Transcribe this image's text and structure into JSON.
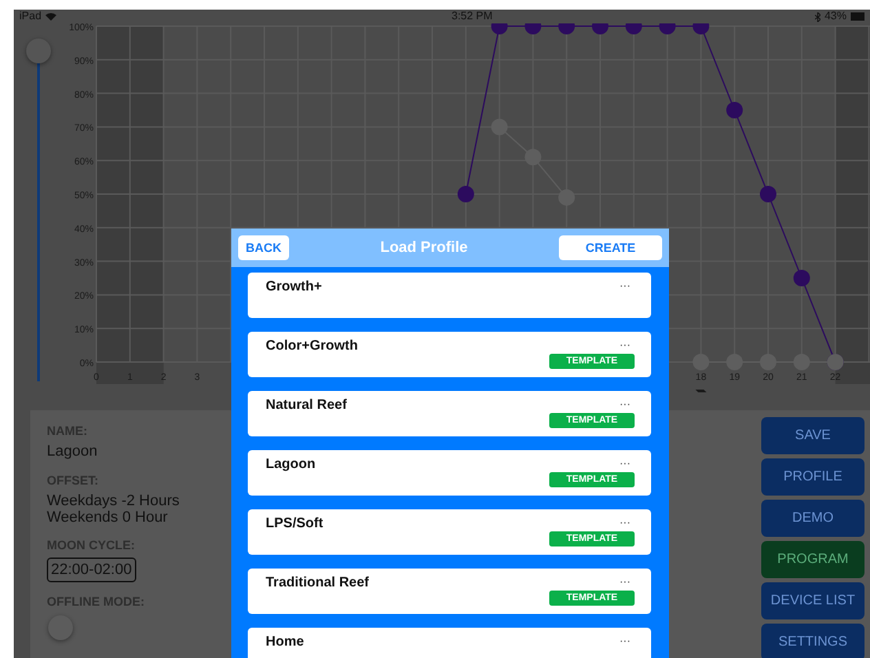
{
  "status_bar": {
    "device": "iPad",
    "time": "3:52 PM",
    "battery": "43%"
  },
  "slider": {
    "level": 1
  },
  "chart_data": {
    "type": "line",
    "x": [
      11,
      12,
      13,
      14,
      15,
      16,
      17,
      18,
      19,
      20,
      21,
      22
    ],
    "xlim": [
      0,
      23
    ],
    "ylim": [
      0,
      100
    ],
    "grid": true,
    "xticks": [
      0,
      1,
      2,
      3,
      18,
      19,
      20,
      21,
      22
    ],
    "yticks": [
      {
        "value": 0,
        "label": "0%"
      },
      {
        "value": 10,
        "label": "10%"
      },
      {
        "value": 20,
        "label": "20%"
      },
      {
        "value": 30,
        "label": "30%"
      },
      {
        "value": 40,
        "label": "40%"
      },
      {
        "value": 50,
        "label": "50%"
      },
      {
        "value": 60,
        "label": "60%"
      },
      {
        "value": 70,
        "label": "70%"
      },
      {
        "value": 80,
        "label": "80%"
      },
      {
        "value": 90,
        "label": "90%"
      },
      {
        "value": 100,
        "label": "100%"
      }
    ],
    "series": [
      {
        "color": "#2c0b5e",
        "marker": "circle",
        "values": [
          50,
          100,
          100,
          100,
          100,
          100,
          100,
          100,
          75,
          50,
          25,
          0
        ]
      },
      {
        "color": "#5e5e5e",
        "marker": "circle",
        "values": [
          null,
          70,
          61,
          49,
          null,
          null,
          null,
          0,
          0,
          0,
          0,
          0
        ]
      }
    ]
  },
  "settings": {
    "name_label": "NAME:",
    "name": "Lagoon",
    "offset_label": "OFFSET:",
    "offset_lines": [
      "Weekdays -2 Hours",
      "Weekends 0 Hour"
    ],
    "moon_label": "MOON CYCLE:",
    "moon_cycle": "22:00-02:00",
    "offline_label": "OFFLINE MODE:",
    "offline_on": false
  },
  "buttons": [
    {
      "label": "SAVE",
      "kind": "normal"
    },
    {
      "label": "PROFILE",
      "kind": "normal"
    },
    {
      "label": "DEMO",
      "kind": "normal"
    },
    {
      "label": "PROGRAM",
      "kind": "active"
    },
    {
      "label": "DEVICE LIST",
      "kind": "normal"
    },
    {
      "label": "SETTINGS",
      "kind": "normal"
    }
  ],
  "modal": {
    "title": "Load Profile",
    "back": "BACK",
    "create": "CREATE",
    "profiles": [
      {
        "name": "Growth+",
        "menu": "···",
        "template": false
      },
      {
        "name": "Color+Growth",
        "menu": "···",
        "template": true,
        "badge": "TEMPLATE"
      },
      {
        "name": "Natural Reef",
        "menu": "···",
        "template": true,
        "badge": "TEMPLATE"
      },
      {
        "name": "Lagoon",
        "menu": "···",
        "template": true,
        "badge": "TEMPLATE"
      },
      {
        "name": "LPS/Soft",
        "menu": "···",
        "template": true,
        "badge": "TEMPLATE"
      },
      {
        "name": "Traditional Reef",
        "menu": "···",
        "template": true,
        "badge": "TEMPLATE"
      },
      {
        "name": "Home",
        "menu": "···",
        "template": false
      }
    ]
  }
}
